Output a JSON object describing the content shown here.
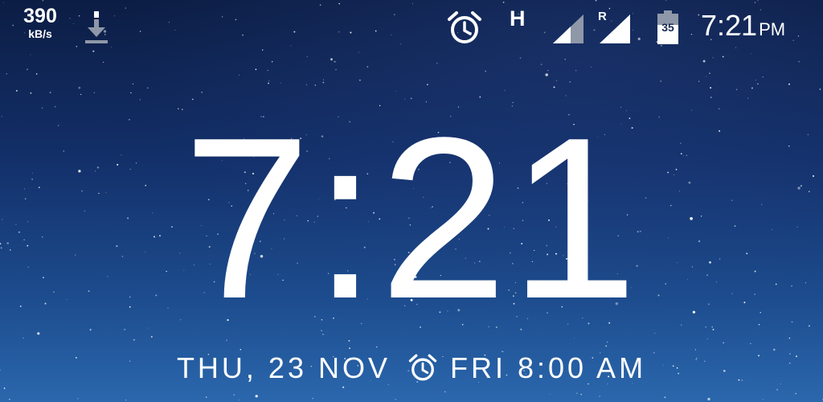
{
  "status_bar": {
    "net_speed_value": "390",
    "net_speed_unit": "kB/s",
    "network_type": "H",
    "roaming_indicator": "R",
    "battery_level": "35",
    "time": "7:21",
    "ampm": "PM",
    "icons": [
      "download-icon",
      "alarm-icon",
      "signal-icon",
      "signal-roaming-icon",
      "battery-icon"
    ]
  },
  "lockscreen": {
    "clock": "7:21",
    "date": "THU, 23 NOV",
    "next_alarm": "FRI 8:00 AM"
  },
  "colors": {
    "text": "#ffffff",
    "sky_top": "#0c1d44",
    "sky_bottom": "#2b67ad"
  }
}
